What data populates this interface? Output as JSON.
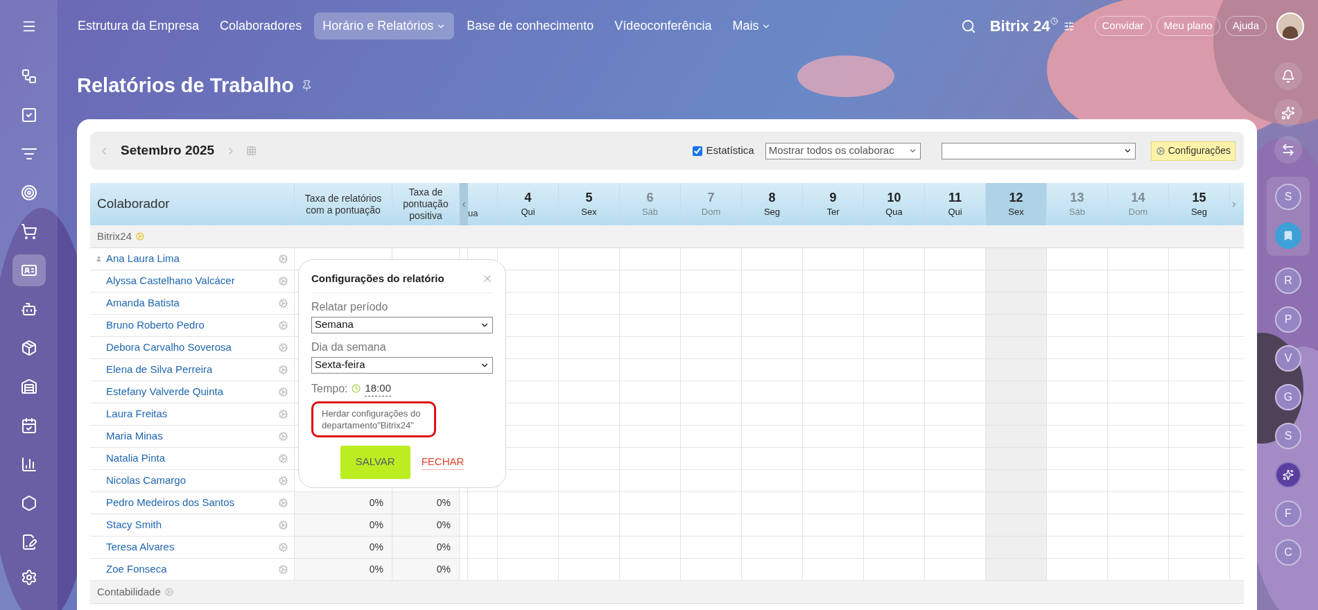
{
  "topbar": {
    "menu": [
      {
        "label": "Estrutura da Empresa",
        "selected": false,
        "dropdown": false
      },
      {
        "label": "Colaboradores",
        "selected": false,
        "dropdown": false
      },
      {
        "label": "Horário e Relatórios",
        "selected": true,
        "dropdown": true
      },
      {
        "label": "Base de conhecimento",
        "selected": false,
        "dropdown": false
      },
      {
        "label": "Vídeoconferência",
        "selected": false,
        "dropdown": false
      },
      {
        "label": "Mais",
        "selected": false,
        "dropdown": true
      }
    ],
    "logo": "Bitrix",
    "logo_suffix": "24",
    "buttons": [
      "Convidar",
      "Meu plano",
      "Ajuda"
    ]
  },
  "left_sidebar": {
    "items": [
      {
        "selected": false
      },
      {
        "selected": false
      },
      {
        "selected": false
      },
      {
        "selected": false
      },
      {
        "selected": false
      },
      {
        "selected": true
      },
      {
        "selected": false
      },
      {
        "selected": false
      },
      {
        "selected": false
      },
      {
        "selected": false
      },
      {
        "selected": false
      },
      {
        "selected": false
      },
      {
        "selected": false
      }
    ]
  },
  "right_sidebar": {
    "items": [
      {
        "kind": "letter",
        "label": "S",
        "pinned": true
      },
      {
        "kind": "bookmark",
        "pinned": true
      },
      {
        "kind": "letter",
        "label": "R",
        "pinned": false
      },
      {
        "kind": "letter",
        "label": "P",
        "pinned": false
      },
      {
        "kind": "letter",
        "label": "V",
        "pinned": false
      },
      {
        "kind": "letter",
        "label": "G",
        "pinned": false
      },
      {
        "kind": "letter",
        "label": "S",
        "pinned": false
      },
      {
        "kind": "icon",
        "pinned": false
      },
      {
        "kind": "letter",
        "label": "F",
        "pinned": false
      },
      {
        "kind": "letter",
        "label": "C",
        "pinned": false
      }
    ]
  },
  "page_title": "Relatórios de Trabalho",
  "toolbar": {
    "month": "Setembro 2025",
    "statistics": {
      "label": "Estatística",
      "checked": true
    },
    "employees_select": "Mostrar todos os colaborac",
    "settings_button": "Configurações"
  },
  "table": {
    "name_column": "Colaborador",
    "rate_columns": [
      "Taxa de relatórios com a pontuação",
      "Taxa de pontuação positiva"
    ],
    "cut_day": {
      "weekday": "ua"
    },
    "days": [
      {
        "number": "4",
        "weekday": "Qui",
        "weekend": false,
        "selected": false
      },
      {
        "number": "5",
        "weekday": "Sex",
        "weekend": false,
        "selected": false
      },
      {
        "number": "6",
        "weekday": "Sáb",
        "weekend": true,
        "selected": false
      },
      {
        "number": "7",
        "weekday": "Dom",
        "weekend": true,
        "selected": false
      },
      {
        "number": "8",
        "weekday": "Seg",
        "weekend": false,
        "selected": false
      },
      {
        "number": "9",
        "weekday": "Ter",
        "weekend": false,
        "selected": false
      },
      {
        "number": "10",
        "weekday": "Qua",
        "weekend": false,
        "selected": false
      },
      {
        "number": "11",
        "weekday": "Qui",
        "weekend": false,
        "selected": false
      },
      {
        "number": "12",
        "weekday": "Sex",
        "weekend": false,
        "selected": true
      },
      {
        "number": "13",
        "weekday": "Sáb",
        "weekend": true,
        "selected": false
      },
      {
        "number": "14",
        "weekday": "Dom",
        "weekend": true,
        "selected": false
      },
      {
        "number": "15",
        "weekday": "Seg",
        "weekend": false,
        "selected": false
      }
    ],
    "groups": [
      {
        "name": "Bitrix24",
        "rows": [
          {
            "name": "Ana Laura Lima",
            "head": true
          },
          {
            "name": "Alyssa Castelhano Valcácer",
            "head": false
          },
          {
            "name": "Amanda Batista",
            "head": false
          },
          {
            "name": "Bruno Roberto Pedro",
            "head": false
          },
          {
            "name": "Debora Carvalho Soverosa",
            "head": false
          },
          {
            "name": "Elena de Silva Perreira",
            "head": false
          },
          {
            "name": "Estefany Valverde Quinta",
            "head": false
          },
          {
            "name": "Laura Freitas",
            "head": false
          },
          {
            "name": "Maria Minas",
            "head": false
          },
          {
            "name": "Natalia Pinta",
            "head": false
          },
          {
            "name": "Nicolas Camargo",
            "head": false
          },
          {
            "name": "Pedro Medeiros dos Santos",
            "head": false,
            "rate_reports": "0%",
            "rate_positive": "0%"
          },
          {
            "name": "Stacy Smith",
            "head": false,
            "rate_reports": "0%",
            "rate_positive": "0%"
          },
          {
            "name": "Teresa Alvares",
            "head": false,
            "rate_reports": "0%",
            "rate_positive": "0%"
          },
          {
            "name": "Zoe Fonseca",
            "head": false,
            "rate_reports": "0%",
            "rate_positive": "0%"
          }
        ]
      },
      {
        "name": "Contabilidade"
      }
    ]
  },
  "popup": {
    "title": "Configurações do relatório",
    "fields": [
      {
        "label": "Relatar período",
        "value": "Semana"
      },
      {
        "label": "Dia da semana",
        "value": "Sexta-feira"
      }
    ],
    "time_label": "Tempo:",
    "time": "18:00",
    "inherit_text": "Herdar configurações do departamento\"Bitrix24\"",
    "highlighted": true,
    "save": "SALVAR",
    "close": "FECHAR"
  }
}
